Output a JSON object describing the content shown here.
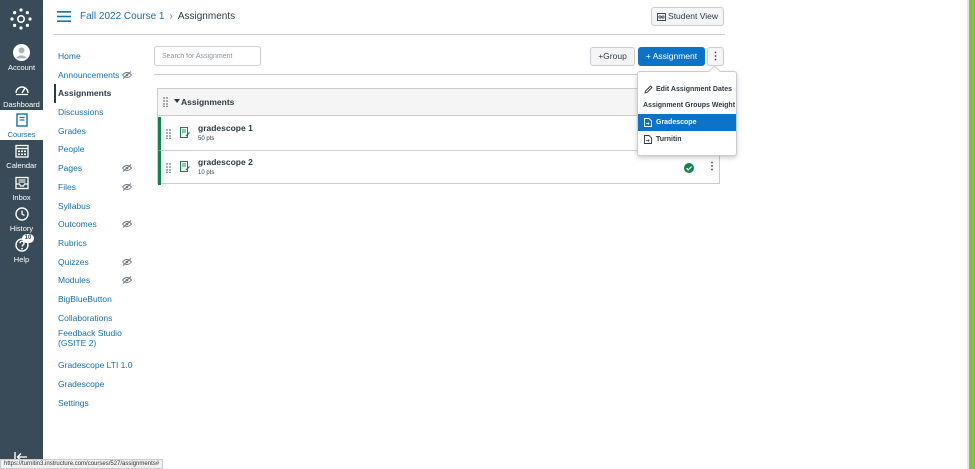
{
  "global_nav": {
    "items": [
      {
        "id": "account",
        "label": "Account",
        "icon": "account-icon"
      },
      {
        "id": "dashboard",
        "label": "Dashboard",
        "icon": "dashboard-icon"
      },
      {
        "id": "courses",
        "label": "Courses",
        "icon": "courses-icon",
        "active": true
      },
      {
        "id": "calendar",
        "label": "Calendar",
        "icon": "calendar-icon"
      },
      {
        "id": "inbox",
        "label": "Inbox",
        "icon": "inbox-icon"
      },
      {
        "id": "history",
        "label": "History",
        "icon": "history-icon"
      },
      {
        "id": "help",
        "label": "Help",
        "icon": "help-icon",
        "badge": "10"
      }
    ]
  },
  "breadcrumb": {
    "course": "Fall 2022 Course 1",
    "separator": "›",
    "page": "Assignments"
  },
  "header": {
    "student_view_label": "Student View"
  },
  "course_nav": {
    "items": [
      {
        "label": "Home"
      },
      {
        "label": "Announcements",
        "hidden": true
      },
      {
        "label": "Assignments",
        "active": true
      },
      {
        "label": "Discussions"
      },
      {
        "label": "Grades"
      },
      {
        "label": "People"
      },
      {
        "label": "Pages",
        "hidden": true
      },
      {
        "label": "Files",
        "hidden": true
      },
      {
        "label": "Syllabus"
      },
      {
        "label": "Outcomes",
        "hidden": true
      },
      {
        "label": "Rubrics"
      },
      {
        "label": "Quizzes",
        "hidden": true
      },
      {
        "label": "Modules",
        "hidden": true
      },
      {
        "label": "BigBlueButton"
      },
      {
        "label": "Collaborations"
      },
      {
        "label": "Feedback Studio (GSITE 2)"
      },
      {
        "label": "Gradescope LTI 1.0"
      },
      {
        "label": "Gradescope"
      },
      {
        "label": "Settings"
      }
    ]
  },
  "toolbar": {
    "search_placeholder": "Search for Assignment",
    "group_label": "+Group",
    "assignment_label": "+ Assignment",
    "kebab_label": "⋮"
  },
  "assignment_group": {
    "title": "Assignments",
    "assignments": [
      {
        "name": "gradescope 1",
        "points": "50 pts",
        "published": true
      },
      {
        "name": "gradescope 2",
        "points": "10 pts",
        "published": true
      }
    ]
  },
  "dropdown_menu": {
    "items": [
      {
        "label": "Edit Assignment Dates",
        "icon": "pencil-icon"
      },
      {
        "label": "Assignment Groups Weight"
      },
      {
        "label": "Gradescope",
        "icon": "external-tool-icon",
        "highlighted": true
      },
      {
        "label": "Turnitin",
        "icon": "external-tool-icon"
      }
    ]
  },
  "status_url": "https://turnitin3.instructure.com/courses/527/assignments#",
  "colors": {
    "global_nav_bg": "#394b58",
    "link_blue": "#1670a9",
    "primary_button": "#0b74c8",
    "published_green": "#0b874b",
    "right_edge_green": "#84c341"
  }
}
